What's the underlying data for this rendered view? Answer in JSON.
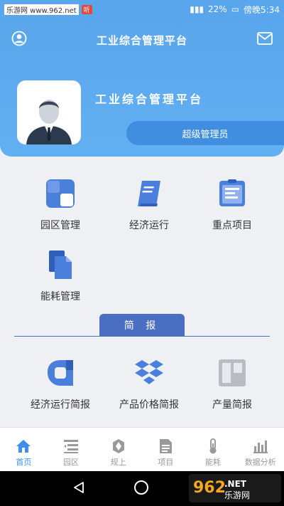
{
  "status_bar": {
    "site": "乐游网 www.962.net",
    "battery": "22%",
    "time": "傍晚5:34"
  },
  "header": {
    "title": "工业综合管理平台",
    "platform_name": "工业综合管理平台",
    "role": "超级管理员"
  },
  "menu": [
    {
      "label": "园区管理",
      "icon": "grid-square-icon"
    },
    {
      "label": "经济运行",
      "icon": "book-icon"
    },
    {
      "label": "重点项目",
      "icon": "clipboard-icon"
    },
    {
      "label": "能耗管理",
      "icon": "documents-icon"
    }
  ],
  "briefing": {
    "title": "简 报",
    "items": [
      {
        "label": "经济运行简报",
        "icon": "d-shape-icon"
      },
      {
        "label": "产品价格简报",
        "icon": "dropbox-icon"
      },
      {
        "label": "产量简报",
        "icon": "panel-icon"
      }
    ]
  },
  "bottom_nav": [
    {
      "label": "首页",
      "icon": "home-icon",
      "active": true
    },
    {
      "label": "园区",
      "icon": "list-icon",
      "active": false
    },
    {
      "label": "规上",
      "icon": "hexagon-icon",
      "active": false
    },
    {
      "label": "项目",
      "icon": "document-icon",
      "active": false
    },
    {
      "label": "能耗",
      "icon": "thermometer-icon",
      "active": false
    },
    {
      "label": "数据分析",
      "icon": "bar-chart-icon",
      "active": false
    }
  ],
  "colors": {
    "header_blue": "#5aa6ec",
    "accent_blue": "#4a6fc2",
    "icon_blue": "#4a7fdc",
    "active_nav": "#3d8ef0"
  },
  "watermark": "962.NET 乐游网"
}
